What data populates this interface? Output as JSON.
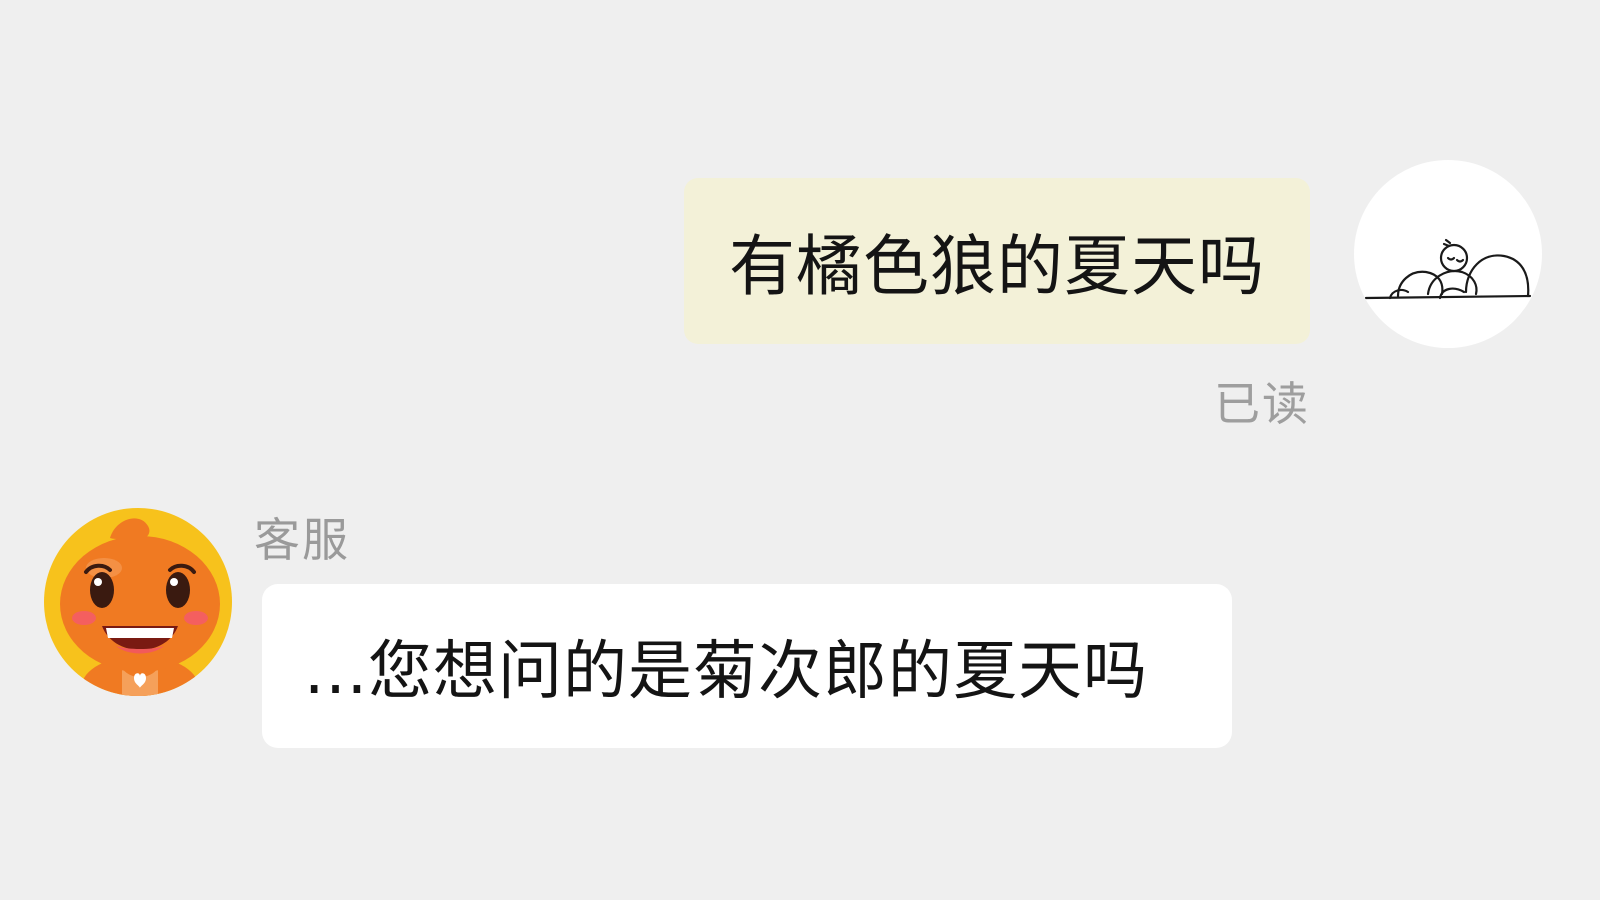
{
  "messages": {
    "outgoing": {
      "text": "有橘色狼的夏天吗",
      "status": "已读",
      "avatar_icon": "sleeping-doodle-icon"
    },
    "incoming": {
      "sender": "客服",
      "text": "...您想问的是菊次郎的夏天吗",
      "avatar_icon": "orange-mascot-icon"
    }
  },
  "colors": {
    "background": "#efefef",
    "outgoing_bubble": "#f3f1d8",
    "incoming_bubble": "#ffffff",
    "agent_avatar_bg": "#f7c21c",
    "mascot_orange": "#f07a22"
  }
}
